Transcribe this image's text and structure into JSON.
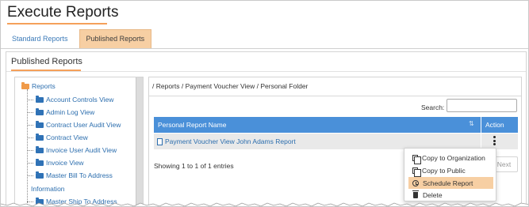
{
  "page": {
    "title": "Execute Reports"
  },
  "tabs": [
    {
      "label": "Standard Reports",
      "active": false
    },
    {
      "label": "Published Reports",
      "active": true
    }
  ],
  "panel": {
    "title": "Published Reports"
  },
  "tree": {
    "root": "Reports",
    "items": [
      "Account Controls View",
      "Admin Log View",
      "Contract User Audit View",
      "Contract View",
      "Invoice User Audit View",
      "Invoice View",
      "Master Bill To Address",
      "Master Ship To Address"
    ],
    "wrapped_text": "Information"
  },
  "content": {
    "breadcrumb": "/ Reports / Payment Voucher View / Personal Folder",
    "search_label": "Search:",
    "search_value": "",
    "table": {
      "headers": {
        "name": "Personal Report Name",
        "action": "Action"
      },
      "rows": [
        {
          "name": "Payment Voucher View John Adams Report"
        }
      ]
    },
    "showing": "Showing 1 to 1 of 1 entries",
    "next_label": "Next"
  },
  "context_menu": {
    "items": [
      {
        "label": "Copy to Organization",
        "icon": "copy-icon"
      },
      {
        "label": "Copy to Public",
        "icon": "copy-icon"
      },
      {
        "label": "Schedule Report",
        "icon": "clock-icon",
        "highlighted": true
      },
      {
        "label": "Delete",
        "icon": "trash-icon"
      }
    ]
  },
  "colors": {
    "accent": "#f5a05a",
    "tab_active": "#f7cfa3",
    "header_blue": "#4a90d9",
    "link": "#2c6eae"
  }
}
